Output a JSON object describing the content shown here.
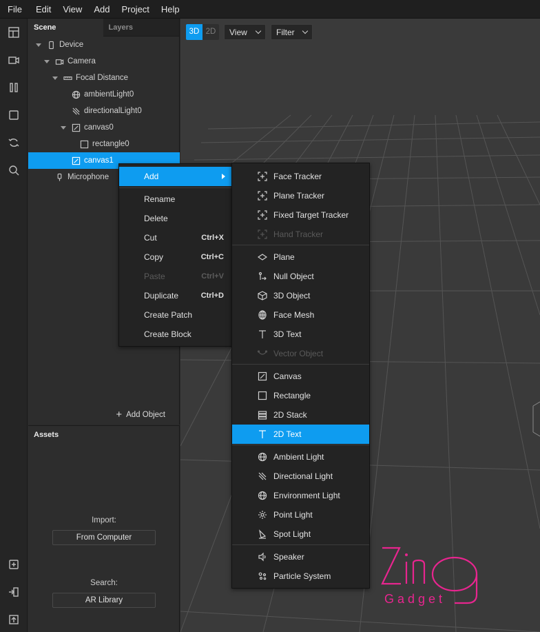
{
  "menubar": {
    "items": [
      "File",
      "Edit",
      "View",
      "Add",
      "Project",
      "Help"
    ]
  },
  "toolbar": {
    "icons": [
      "layout-icon",
      "video-icon",
      "patch-icon",
      "square-icon",
      "sync-icon",
      "search-icon",
      "add-folder-icon",
      "import-icon",
      "export-icon"
    ]
  },
  "scene": {
    "tabs": {
      "scene": "Scene",
      "layers": "Layers"
    },
    "tree": [
      {
        "label": "Device",
        "icon": "device-icon"
      },
      {
        "label": "Camera",
        "icon": "camera-icon"
      },
      {
        "label": "Focal Distance",
        "icon": "focal-distance-icon"
      },
      {
        "label": "ambientLight0",
        "icon": "globe-icon"
      },
      {
        "label": "directionalLight0",
        "icon": "directional-light-icon"
      },
      {
        "label": "canvas0",
        "icon": "canvas-icon"
      },
      {
        "label": "rectangle0",
        "icon": "rectangle-icon"
      },
      {
        "label": "canvas1",
        "icon": "canvas-icon",
        "selected": true
      },
      {
        "label": "Microphone",
        "icon": "microphone-icon"
      }
    ],
    "add_object": "Add Object"
  },
  "assets": {
    "title": "Assets",
    "import_label": "Import:",
    "from_computer": "From Computer",
    "search_label": "Search:",
    "ar_library": "AR Library"
  },
  "viewport": {
    "mode_3d": "3D",
    "mode_2d": "2D",
    "active_mode": "3D",
    "view_dropdown": "View",
    "filter_dropdown": "Filter"
  },
  "context_menu": {
    "items": [
      {
        "label": "Add",
        "shortcut": "",
        "state": "active",
        "submenu": true
      },
      {
        "label": "Rename",
        "shortcut": "",
        "state": "normal"
      },
      {
        "label": "Delete",
        "shortcut": "",
        "state": "normal"
      },
      {
        "label": "Cut",
        "shortcut": "Ctrl+X",
        "state": "normal"
      },
      {
        "label": "Copy",
        "shortcut": "Ctrl+C",
        "state": "normal"
      },
      {
        "label": "Paste",
        "shortcut": "Ctrl+V",
        "state": "disabled"
      },
      {
        "label": "Duplicate",
        "shortcut": "Ctrl+D",
        "state": "normal"
      },
      {
        "label": "Create Patch",
        "shortcut": "",
        "state": "normal"
      },
      {
        "label": "Create Block",
        "shortcut": "",
        "state": "normal"
      }
    ]
  },
  "add_submenu": {
    "groups": [
      [
        {
          "label": "Face Tracker",
          "icon": "face-tracker-icon",
          "state": "normal"
        },
        {
          "label": "Plane Tracker",
          "icon": "plane-tracker-icon",
          "state": "normal"
        },
        {
          "label": "Fixed Target Tracker",
          "icon": "fixed-target-tracker-icon",
          "state": "normal"
        },
        {
          "label": "Hand Tracker",
          "icon": "hand-tracker-icon",
          "state": "disabled"
        }
      ],
      [
        {
          "label": "Plane",
          "icon": "plane-icon",
          "state": "normal"
        },
        {
          "label": "Null Object",
          "icon": "null-object-icon",
          "state": "normal"
        },
        {
          "label": "3D Object",
          "icon": "cube-icon",
          "state": "normal"
        },
        {
          "label": "Face Mesh",
          "icon": "face-mesh-icon",
          "state": "normal"
        },
        {
          "label": "3D Text",
          "icon": "text-icon",
          "state": "normal"
        },
        {
          "label": "Vector Object",
          "icon": "vector-object-icon",
          "state": "disabled"
        }
      ],
      [
        {
          "label": "Canvas",
          "icon": "canvas-icon",
          "state": "normal"
        },
        {
          "label": "Rectangle",
          "icon": "rectangle-icon",
          "state": "normal"
        },
        {
          "label": "2D Stack",
          "icon": "stack-icon",
          "state": "normal"
        },
        {
          "label": "2D Text",
          "icon": "text-icon",
          "state": "active"
        }
      ],
      [
        {
          "label": "Ambient Light",
          "icon": "globe-icon",
          "state": "normal"
        },
        {
          "label": "Directional Light",
          "icon": "directional-light-icon",
          "state": "normal"
        },
        {
          "label": "Environment Light",
          "icon": "globe-icon",
          "state": "normal"
        },
        {
          "label": "Point Light",
          "icon": "point-light-icon",
          "state": "normal"
        },
        {
          "label": "Spot Light",
          "icon": "spot-light-icon",
          "state": "normal"
        }
      ],
      [
        {
          "label": "Speaker",
          "icon": "speaker-icon",
          "state": "normal"
        },
        {
          "label": "Particle System",
          "icon": "particle-system-icon",
          "state": "normal"
        }
      ]
    ]
  },
  "watermark": {
    "brand": "Zing",
    "sub": "Gadget",
    "color": "#e8258f"
  },
  "colors": {
    "accent": "#0e9cf0",
    "menu_bg": "#232323",
    "panel_bg": "#2d2d2d"
  }
}
